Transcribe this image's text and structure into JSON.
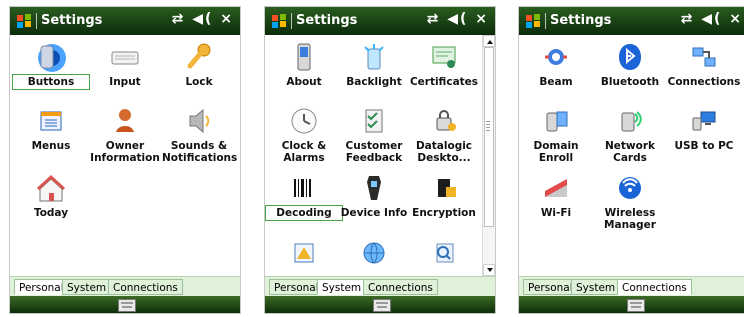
{
  "title": "Settings",
  "tray": {
    "signal": "⇄",
    "volume": "◀(",
    "close": "×"
  },
  "tabs": [
    "Personal",
    "System",
    "Connections"
  ],
  "panel1": {
    "items": [
      {
        "label": "Buttons"
      },
      {
        "label": "Input"
      },
      {
        "label": "Lock"
      },
      {
        "label": "Menus"
      },
      {
        "label": "Owner\nInformation"
      },
      {
        "label": "Sounds &\nNotifications"
      },
      {
        "label": "Today"
      }
    ]
  },
  "panel2": {
    "items": [
      {
        "label": "About"
      },
      {
        "label": "Backlight"
      },
      {
        "label": "Certificates"
      },
      {
        "label": "Clock &\nAlarms"
      },
      {
        "label": "Customer\nFeedback"
      },
      {
        "label": "Datalogic\nDeskto..."
      },
      {
        "label": "Decoding"
      },
      {
        "label": "Device Info"
      },
      {
        "label": "Encryption"
      }
    ]
  },
  "panel3": {
    "items": [
      {
        "label": "Beam"
      },
      {
        "label": "Bluetooth"
      },
      {
        "label": "Connections"
      },
      {
        "label": "Domain\nEnroll"
      },
      {
        "label": "Network\nCards"
      },
      {
        "label": "USB to PC"
      },
      {
        "label": "Wi-Fi"
      },
      {
        "label": "Wireless\nManager"
      }
    ]
  }
}
